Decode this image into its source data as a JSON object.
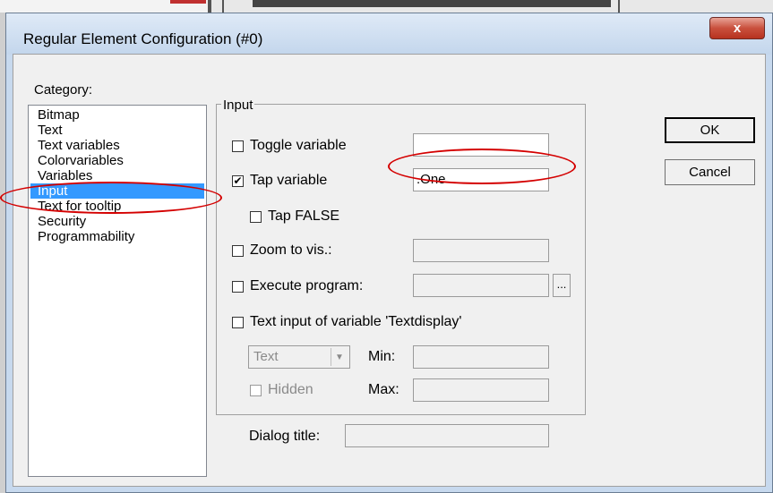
{
  "window": {
    "title": "Regular Element Configuration (#0)",
    "close_label": "x"
  },
  "category": {
    "label": "Category:",
    "items": [
      "Bitmap",
      "Text",
      "Text variables",
      "Colorvariables",
      "Variables",
      "Input",
      "Text for tooltip",
      "Security",
      "Programmability"
    ],
    "selected": "Input"
  },
  "input_group": {
    "legend": "Input",
    "toggle_variable": {
      "label": "Toggle variable",
      "checked": false,
      "value": ""
    },
    "tap_variable": {
      "label": "Tap variable",
      "checked": true,
      "value": ".One"
    },
    "tap_false": {
      "label": "Tap FALSE",
      "checked": false
    },
    "zoom_to_vis": {
      "label": "Zoom to vis.:",
      "checked": false,
      "value": ""
    },
    "execute_program": {
      "label": "Execute program:",
      "checked": false,
      "value": "",
      "browse_label": "..."
    },
    "text_input": {
      "label": "Text input of variable 'Textdisplay'",
      "checked": false
    },
    "type_select": {
      "value": "Text"
    },
    "min_label": "Min:",
    "max_label": "Max:",
    "hidden": {
      "label": "Hidden",
      "checked": false
    }
  },
  "dialog_title": {
    "label": "Dialog title:",
    "value": ""
  },
  "buttons": {
    "ok": "OK",
    "cancel": "Cancel"
  },
  "annotation_color": "#d40000",
  "selection_color": "#3399ff"
}
